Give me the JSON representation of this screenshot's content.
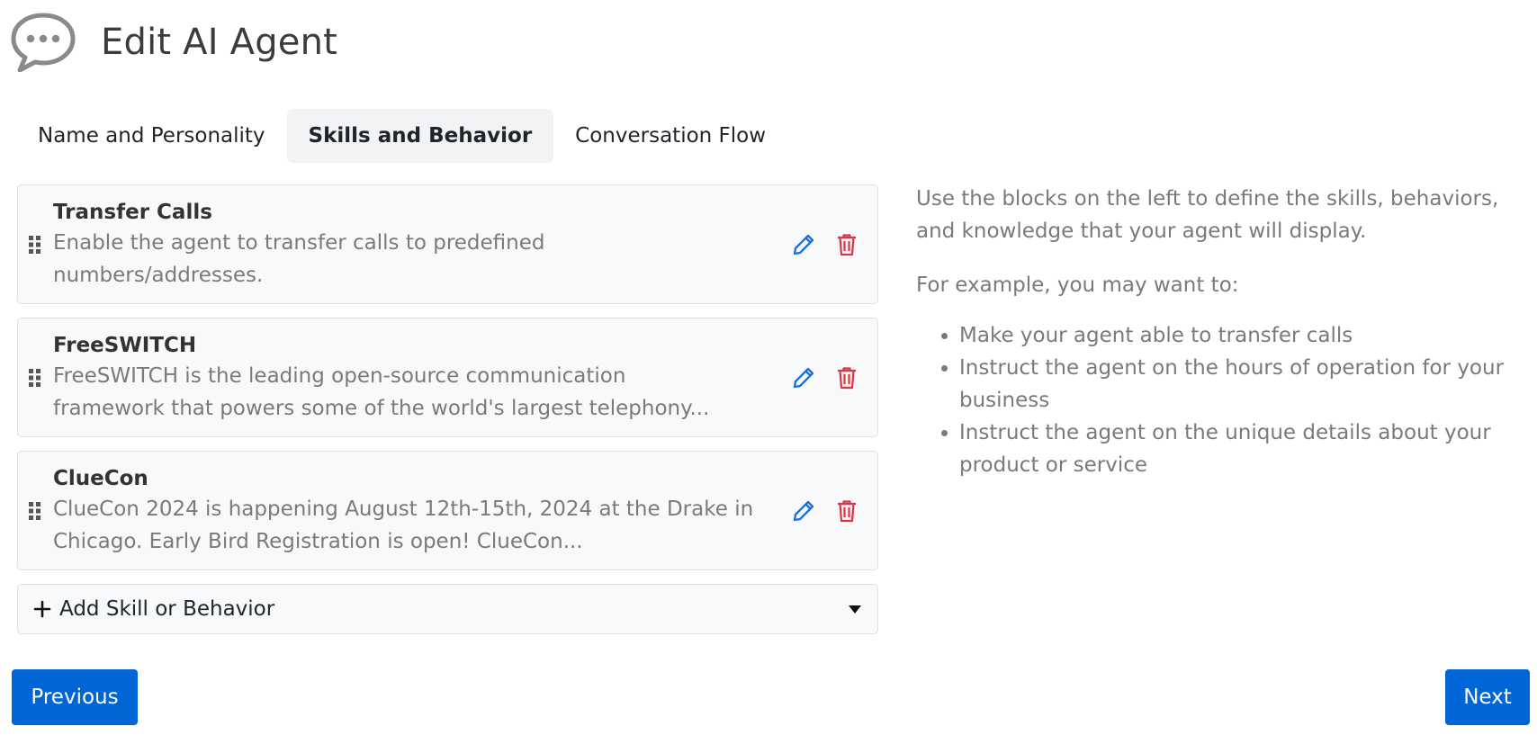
{
  "header": {
    "title": "Edit AI Agent",
    "logo_icon": "chat-bubble-icon"
  },
  "tabs": [
    {
      "label": "Name and Personality",
      "active": false
    },
    {
      "label": "Skills and Behavior",
      "active": true
    },
    {
      "label": "Conversation Flow",
      "active": false
    }
  ],
  "skills": [
    {
      "title": "Transfer Calls",
      "desc_line1": "Enable the agent to transfer calls to predefined",
      "desc_line2": "numbers/addresses."
    },
    {
      "title": "FreeSWITCH",
      "desc_line1": "FreeSWITCH is the leading open-source communication",
      "desc_line2": "framework that powers some of the world's largest telephony..."
    },
    {
      "title": "ClueCon",
      "desc_line1": "ClueCon 2024 is happening August 12th-15th, 2024 at the Drake in",
      "desc_line2": "Chicago. Early Bird Registration is open! ClueCon..."
    }
  ],
  "add_skill": {
    "label": "Add Skill or Behavior"
  },
  "help": {
    "paragraph1": "Use the blocks on the left to define the skills, behaviors, and knowledge that your agent will display.",
    "paragraph2": "For example, you may want to:",
    "items": [
      "Make your agent able to transfer calls",
      "Instruct the agent on the hours of operation for your business",
      "Instruct the agent on the unique details about your product or service"
    ]
  },
  "buttons": {
    "previous": "Previous",
    "next": "Next"
  },
  "colors": {
    "primary": "#0066d6",
    "edit": "#1a6fd4",
    "delete": "#dc3545",
    "muted_text": "#7a7a7a",
    "card_bg": "#f8f9fa"
  }
}
